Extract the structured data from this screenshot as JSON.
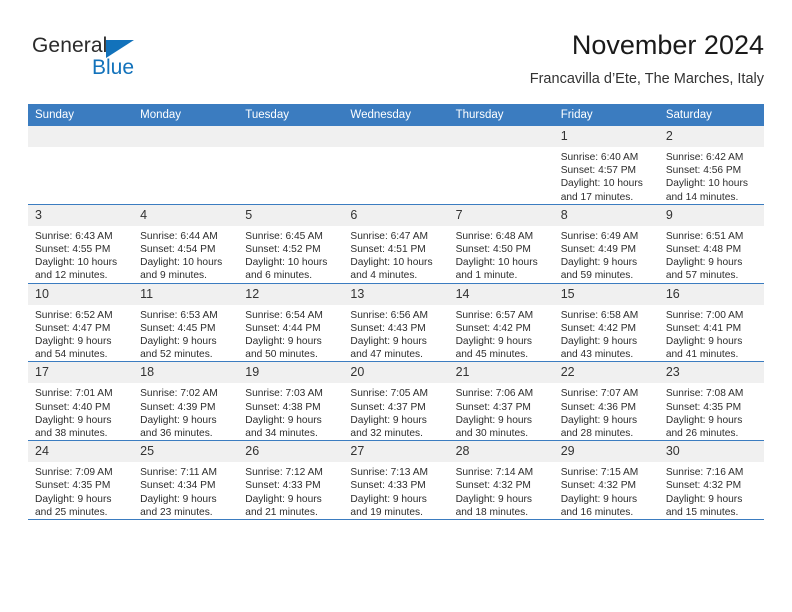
{
  "brand": {
    "name_part1": "General",
    "name_part2": "Blue",
    "triangle_color": "#1272bb"
  },
  "header": {
    "title": "November 2024",
    "subtitle": "Francavilla d’Ete, The Marches, Italy"
  },
  "theme": {
    "header_blue": "#3b7cc0",
    "daynum_band": "#f0f0f0",
    "text": "#2d2d2d"
  },
  "calendar": {
    "weekday_headers": [
      "Sunday",
      "Monday",
      "Tuesday",
      "Wednesday",
      "Thursday",
      "Friday",
      "Saturday"
    ],
    "weeks": [
      [
        {
          "day": "",
          "empty": true
        },
        {
          "day": "",
          "empty": true
        },
        {
          "day": "",
          "empty": true
        },
        {
          "day": "",
          "empty": true
        },
        {
          "day": "",
          "empty": true
        },
        {
          "day": "1",
          "sunrise": "Sunrise: 6:40 AM",
          "sunset": "Sunset: 4:57 PM",
          "daylight": "Daylight: 10 hours and 17 minutes."
        },
        {
          "day": "2",
          "sunrise": "Sunrise: 6:42 AM",
          "sunset": "Sunset: 4:56 PM",
          "daylight": "Daylight: 10 hours and 14 minutes."
        }
      ],
      [
        {
          "day": "3",
          "sunrise": "Sunrise: 6:43 AM",
          "sunset": "Sunset: 4:55 PM",
          "daylight": "Daylight: 10 hours and 12 minutes."
        },
        {
          "day": "4",
          "sunrise": "Sunrise: 6:44 AM",
          "sunset": "Sunset: 4:54 PM",
          "daylight": "Daylight: 10 hours and 9 minutes."
        },
        {
          "day": "5",
          "sunrise": "Sunrise: 6:45 AM",
          "sunset": "Sunset: 4:52 PM",
          "daylight": "Daylight: 10 hours and 6 minutes."
        },
        {
          "day": "6",
          "sunrise": "Sunrise: 6:47 AM",
          "sunset": "Sunset: 4:51 PM",
          "daylight": "Daylight: 10 hours and 4 minutes."
        },
        {
          "day": "7",
          "sunrise": "Sunrise: 6:48 AM",
          "sunset": "Sunset: 4:50 PM",
          "daylight": "Daylight: 10 hours and 1 minute."
        },
        {
          "day": "8",
          "sunrise": "Sunrise: 6:49 AM",
          "sunset": "Sunset: 4:49 PM",
          "daylight": "Daylight: 9 hours and 59 minutes."
        },
        {
          "day": "9",
          "sunrise": "Sunrise: 6:51 AM",
          "sunset": "Sunset: 4:48 PM",
          "daylight": "Daylight: 9 hours and 57 minutes."
        }
      ],
      [
        {
          "day": "10",
          "sunrise": "Sunrise: 6:52 AM",
          "sunset": "Sunset: 4:47 PM",
          "daylight": "Daylight: 9 hours and 54 minutes."
        },
        {
          "day": "11",
          "sunrise": "Sunrise: 6:53 AM",
          "sunset": "Sunset: 4:45 PM",
          "daylight": "Daylight: 9 hours and 52 minutes."
        },
        {
          "day": "12",
          "sunrise": "Sunrise: 6:54 AM",
          "sunset": "Sunset: 4:44 PM",
          "daylight": "Daylight: 9 hours and 50 minutes."
        },
        {
          "day": "13",
          "sunrise": "Sunrise: 6:56 AM",
          "sunset": "Sunset: 4:43 PM",
          "daylight": "Daylight: 9 hours and 47 minutes."
        },
        {
          "day": "14",
          "sunrise": "Sunrise: 6:57 AM",
          "sunset": "Sunset: 4:42 PM",
          "daylight": "Daylight: 9 hours and 45 minutes."
        },
        {
          "day": "15",
          "sunrise": "Sunrise: 6:58 AM",
          "sunset": "Sunset: 4:42 PM",
          "daylight": "Daylight: 9 hours and 43 minutes."
        },
        {
          "day": "16",
          "sunrise": "Sunrise: 7:00 AM",
          "sunset": "Sunset: 4:41 PM",
          "daylight": "Daylight: 9 hours and 41 minutes."
        }
      ],
      [
        {
          "day": "17",
          "sunrise": "Sunrise: 7:01 AM",
          "sunset": "Sunset: 4:40 PM",
          "daylight": "Daylight: 9 hours and 38 minutes."
        },
        {
          "day": "18",
          "sunrise": "Sunrise: 7:02 AM",
          "sunset": "Sunset: 4:39 PM",
          "daylight": "Daylight: 9 hours and 36 minutes."
        },
        {
          "day": "19",
          "sunrise": "Sunrise: 7:03 AM",
          "sunset": "Sunset: 4:38 PM",
          "daylight": "Daylight: 9 hours and 34 minutes."
        },
        {
          "day": "20",
          "sunrise": "Sunrise: 7:05 AM",
          "sunset": "Sunset: 4:37 PM",
          "daylight": "Daylight: 9 hours and 32 minutes."
        },
        {
          "day": "21",
          "sunrise": "Sunrise: 7:06 AM",
          "sunset": "Sunset: 4:37 PM",
          "daylight": "Daylight: 9 hours and 30 minutes."
        },
        {
          "day": "22",
          "sunrise": "Sunrise: 7:07 AM",
          "sunset": "Sunset: 4:36 PM",
          "daylight": "Daylight: 9 hours and 28 minutes."
        },
        {
          "day": "23",
          "sunrise": "Sunrise: 7:08 AM",
          "sunset": "Sunset: 4:35 PM",
          "daylight": "Daylight: 9 hours and 26 minutes."
        }
      ],
      [
        {
          "day": "24",
          "sunrise": "Sunrise: 7:09 AM",
          "sunset": "Sunset: 4:35 PM",
          "daylight": "Daylight: 9 hours and 25 minutes."
        },
        {
          "day": "25",
          "sunrise": "Sunrise: 7:11 AM",
          "sunset": "Sunset: 4:34 PM",
          "daylight": "Daylight: 9 hours and 23 minutes."
        },
        {
          "day": "26",
          "sunrise": "Sunrise: 7:12 AM",
          "sunset": "Sunset: 4:33 PM",
          "daylight": "Daylight: 9 hours and 21 minutes."
        },
        {
          "day": "27",
          "sunrise": "Sunrise: 7:13 AM",
          "sunset": "Sunset: 4:33 PM",
          "daylight": "Daylight: 9 hours and 19 minutes."
        },
        {
          "day": "28",
          "sunrise": "Sunrise: 7:14 AM",
          "sunset": "Sunset: 4:32 PM",
          "daylight": "Daylight: 9 hours and 18 minutes."
        },
        {
          "day": "29",
          "sunrise": "Sunrise: 7:15 AM",
          "sunset": "Sunset: 4:32 PM",
          "daylight": "Daylight: 9 hours and 16 minutes."
        },
        {
          "day": "30",
          "sunrise": "Sunrise: 7:16 AM",
          "sunset": "Sunset: 4:32 PM",
          "daylight": "Daylight: 9 hours and 15 minutes."
        }
      ]
    ]
  }
}
